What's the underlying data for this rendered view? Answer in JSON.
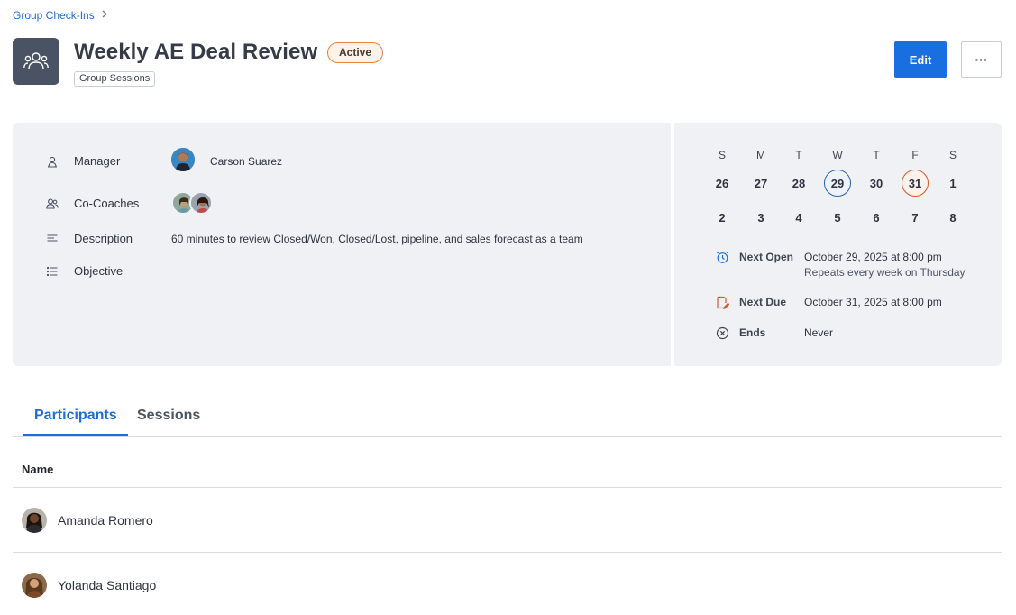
{
  "breadcrumb": {
    "parent": "Group Check-Ins"
  },
  "header": {
    "title": "Weekly AE Deal Review",
    "status": "Active",
    "type_tag": "Group Sessions",
    "edit_label": "Edit",
    "more_label": "···"
  },
  "details": {
    "manager_label": "Manager",
    "manager_name": "Carson Suarez",
    "cocoaches_label": "Co-Coaches",
    "description_label": "Description",
    "description_value": "60 minutes to review Closed/Won, Closed/Lost, pipeline, and sales forecast as a team",
    "objective_label": "Objective"
  },
  "calendar": {
    "weekdays": [
      "S",
      "M",
      "T",
      "W",
      "T",
      "F",
      "S"
    ],
    "week1": [
      "26",
      "27",
      "28",
      "29",
      "30",
      "31",
      "1"
    ],
    "week2": [
      "2",
      "3",
      "4",
      "5",
      "6",
      "7",
      "8"
    ],
    "today": "29",
    "due": "31"
  },
  "schedule": {
    "next_open_label": "Next Open",
    "next_open_value": "October 29, 2025 at 8:00 pm",
    "repeat_text": "Repeats every week on Thursday",
    "next_due_label": "Next Due",
    "next_due_value": "October 31, 2025 at 8:00 pm",
    "ends_label": "Ends",
    "ends_value": "Never"
  },
  "tabs": {
    "participants": "Participants",
    "sessions": "Sessions"
  },
  "table": {
    "column_name": "Name",
    "rows": [
      {
        "name": "Amanda Romero"
      },
      {
        "name": "Yolanda Santiago"
      }
    ]
  },
  "colors": {
    "accent": "#1a6fe0",
    "status_border": "#e8843c",
    "due": "#d9582c",
    "today": "#2b5faa"
  }
}
